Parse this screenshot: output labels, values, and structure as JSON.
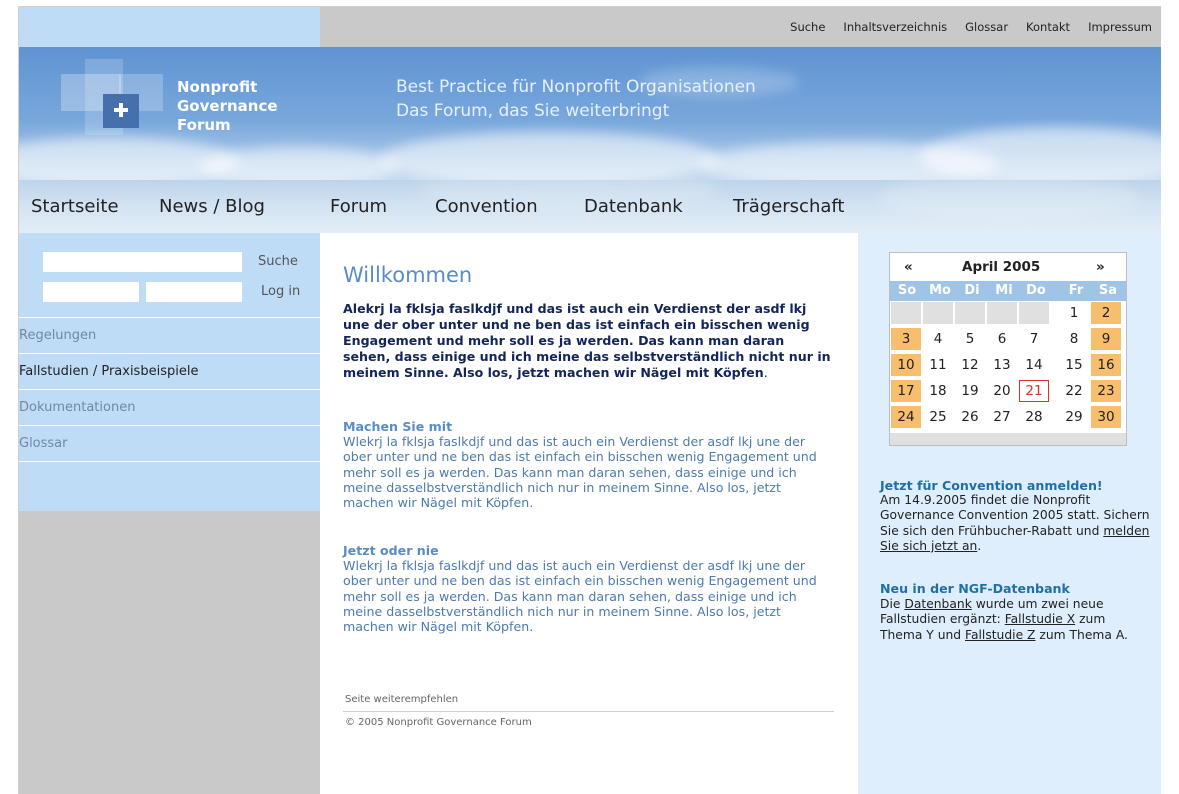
{
  "topnav": {
    "links": [
      "Suche",
      "Inhaltsverzeichnis",
      "Glossar",
      "Kontakt",
      "Impressum"
    ]
  },
  "logo": {
    "line1": "Nonprofit",
    "line2": "Governance",
    "line3": "Forum",
    "icon": "plus-icon"
  },
  "tagline": {
    "line1": "Best Practice für Nonprofit Organisationen",
    "line2": "Das Forum, das Sie weiterbringt"
  },
  "mainnav": {
    "items": [
      "Startseite",
      "News / Blog",
      "Forum",
      "Convention",
      "Datenbank",
      "Trägerschaft"
    ]
  },
  "sidebar": {
    "search_label": "Suche",
    "login_label": "Log in",
    "items": [
      "Regelungen",
      "Fallstudien / Praxisbeispiele",
      "Dokumentationen",
      "Glossar"
    ]
  },
  "main": {
    "title": "Willkommen",
    "lead": "Alekrj la fklsja faslkdjf und das ist auch ein Verdienst der asdf lkj une der ober unter und ne ben das ist einfach ein bisschen wenig Engagement und mehr soll es ja werden. Das kann man daran sehen, dass einige und ich meine das selbstverständlich nicht nur in meinem Sinne. Also los, jetzt machen wir Nägel mit Köpfen",
    "lead_end": ".",
    "sections": [
      {
        "heading": "Machen Sie mit",
        "text": "Wlekrj la fklsja faslkdjf und das ist auch ein Verdienst der  asdf lkj une der ober unter und ne ben das ist einfach ein bisschen wenig Engagement und mehr soll es ja werden. Das kann man daran sehen, dass einige und ich meine dasselbstverständlich nich nur in meinem Sinne. Also los, jetzt machen wir Nägel mit Köpfen."
      },
      {
        "heading": "Jetzt oder nie",
        "text": "Wlekrj la fklsja faslkdjf und das ist auch ein Verdienst der  asdf lkj une der ober unter und ne ben das ist einfach ein bisschen wenig Engagement und mehr soll es ja werden. Das kann man daran sehen, dass einige und ich meine dasselbstverständlich nich nur in meinem Sinne. Also los, jetzt machen wir Nägel mit Köpfen."
      }
    ],
    "recommend": "Seite weiterempfehlen",
    "copyright": "© 2005 Nonprofit Governance Forum"
  },
  "calendar": {
    "prev": "«",
    "next": "»",
    "title": "April 2005",
    "weekdays": [
      "So",
      "Mo",
      "Di",
      "Mi",
      "Do",
      "Fr",
      "Sa"
    ],
    "weeks": [
      [
        "",
        "",
        "",
        "",
        "",
        "1",
        "2"
      ],
      [
        "3",
        "4",
        "5",
        "6",
        "7",
        "8",
        "9"
      ],
      [
        "10",
        "11",
        "12",
        "13",
        "14",
        "15",
        "16"
      ],
      [
        "17",
        "18",
        "19",
        "20",
        "21",
        "22",
        "23"
      ],
      [
        "24",
        "25",
        "26",
        "27",
        "28",
        "29",
        "30"
      ]
    ],
    "today": "21",
    "weekend_color": "#f7be6e",
    "today_border_color": "#d9302c"
  },
  "news": [
    {
      "heading": "Jetzt für Convention anmelden!",
      "parts": [
        {
          "text": "Am 14.9.2005 findet die Nonprofit Governance Convention 2005 statt. Sichern Sie sich den Frühbucher-Rabatt und ",
          "link": false
        },
        {
          "text": "melden Sie sich jetzt an",
          "link": true
        },
        {
          "text": ".",
          "link": false
        }
      ]
    },
    {
      "heading": "Neu in der NGF-Datenbank",
      "parts": [
        {
          "text": "Die ",
          "link": false
        },
        {
          "text": "Datenbank",
          "link": true
        },
        {
          "text": " wurde um zwei neue Fallstudien ergänzt: ",
          "link": false
        },
        {
          "text": "Fallstudie X",
          "link": true
        },
        {
          "text": " zum Thema Y und ",
          "link": false
        },
        {
          "text": "Fallstudie Z",
          "link": true
        },
        {
          "text": " zum Thema A.",
          "link": false
        }
      ]
    }
  ],
  "colors": {
    "accent": "#5a8cc4",
    "sidebar_bg": "#bfdcf6",
    "right_bg": "#dfeefc"
  }
}
